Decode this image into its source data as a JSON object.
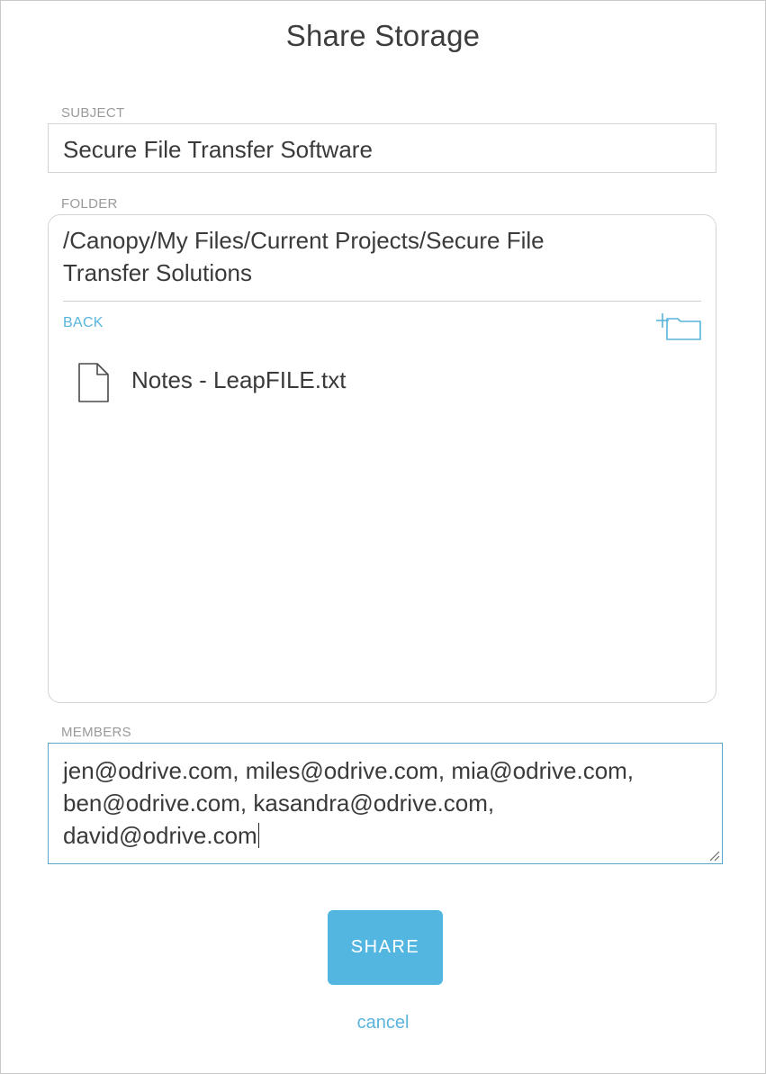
{
  "dialog": {
    "title": "Share Storage"
  },
  "subject": {
    "label": "SUBJECT",
    "value": "Secure File Transfer Software"
  },
  "folder": {
    "label": "FOLDER",
    "path_line1": "/Canopy/My Files/Current Projects/Secure File",
    "path_line2": "Transfer Solutions",
    "back_label": "BACK",
    "new_folder_icon": "folder-plus-icon",
    "files": [
      {
        "icon": "file-icon",
        "name": "Notes - LeapFILE.txt"
      }
    ]
  },
  "members": {
    "label": "MEMBERS",
    "line1": "jen@odrive.com, miles@odrive.com, mia@odrive.com,",
    "line2": "ben@odrive.com, kasandra@odrive.com,",
    "line3": "david@odrive.com"
  },
  "actions": {
    "share_label": "SHARE",
    "cancel_label": "cancel"
  },
  "colors": {
    "accent": "#52b6e0",
    "link": "#5ab4dc",
    "focus_border": "#5aa7c9",
    "label_gray": "#9a9a9a"
  }
}
